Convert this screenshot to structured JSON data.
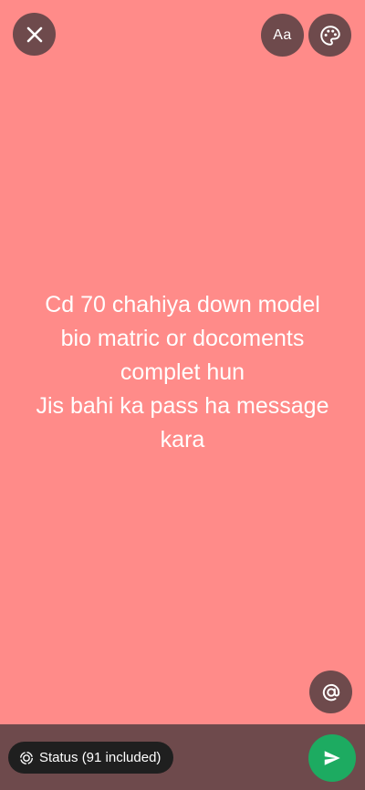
{
  "toolbar": {
    "close_icon": "close-icon",
    "text_style_label": "Aa",
    "palette_icon": "palette-icon"
  },
  "status": {
    "lines": [
      "Cd 70 chahiya down model",
      "bio matric or docoments",
      "complet hun",
      "Jis bahi ka pass ha message",
      "kara"
    ],
    "background_color": "#FF8B89"
  },
  "mention": {
    "icon": "at-icon"
  },
  "footer": {
    "audience_label": "Status (91 included)",
    "audience_icon": "status-ring-icon",
    "send_icon": "send-icon",
    "send_color": "#1DAB61",
    "bar_color": "#6E4A4C"
  }
}
